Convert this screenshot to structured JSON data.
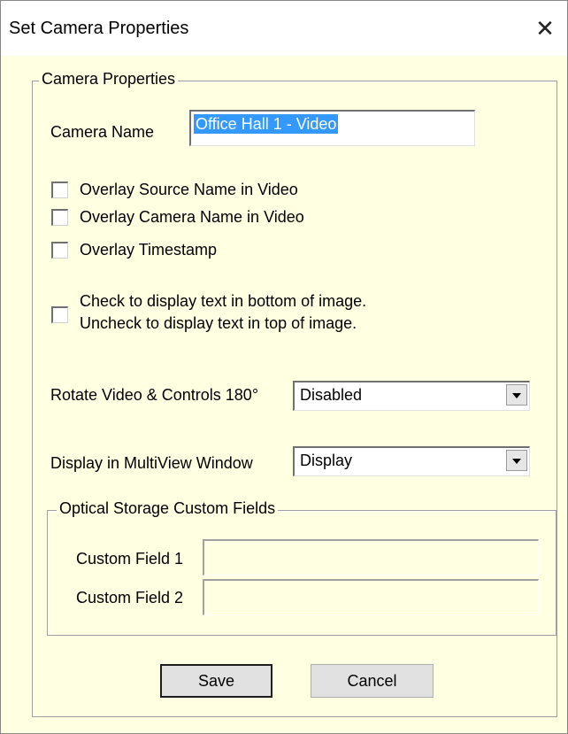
{
  "window": {
    "title": "Set Camera Properties",
    "close_glyph": "✕"
  },
  "camera_properties": {
    "legend": "Camera Properties",
    "camera_name_label": "Camera Name",
    "camera_name_value": "Office Hall 1 - Video",
    "checkboxes": [
      {
        "label": "Overlay Source Name in Video",
        "checked": false
      },
      {
        "label": "Overlay Camera Name in Video",
        "checked": false
      },
      {
        "label": "Overlay Timestamp",
        "checked": false
      }
    ],
    "text_position": {
      "line1": "Check to display text in bottom of image.",
      "line2": "Uncheck to display text in top of image.",
      "checked": false
    },
    "rotate": {
      "label": "Rotate Video & Controls 180°",
      "value": "Disabled"
    },
    "multiview": {
      "label": "Display in MultiView Window",
      "value": "Display"
    },
    "optical_storage": {
      "legend": "Optical Storage Custom Fields",
      "field1_label": "Custom Field 1",
      "field1_value": "",
      "field2_label": "Custom Field 2",
      "field2_value": ""
    }
  },
  "buttons": {
    "save": "Save",
    "cancel": "Cancel"
  },
  "colors": {
    "dialog_background": "#ffffe1",
    "selection_highlight": "#3399ff"
  }
}
